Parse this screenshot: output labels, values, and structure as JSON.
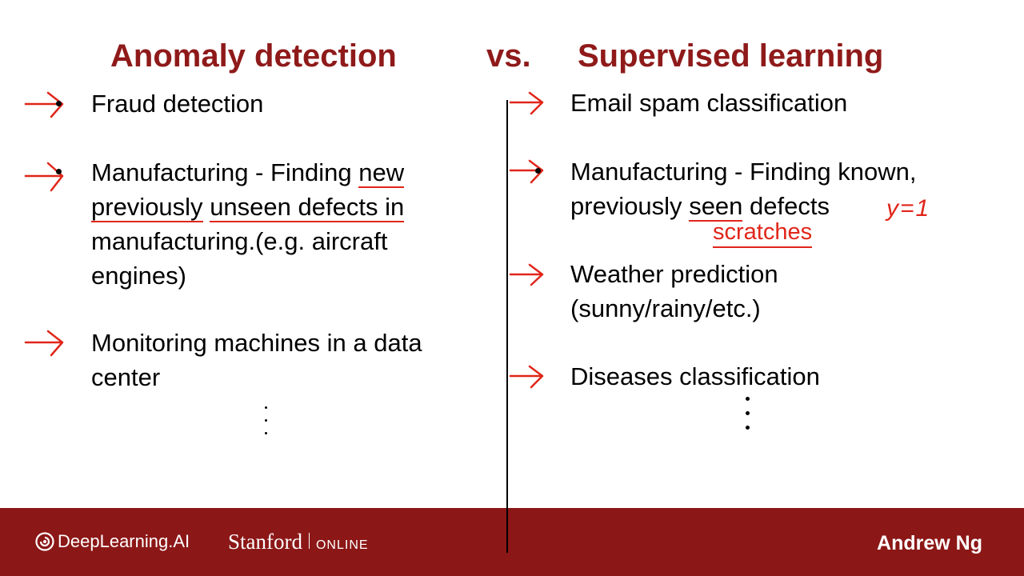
{
  "titles": {
    "left": "Anomaly detection",
    "vs": "vs.",
    "right": "Supervised learning"
  },
  "left_items": [
    "Fraud detection",
    "Manufacturing -  Finding new previously unseen defects in manufacturing.(e.g. aircraft engines)",
    "Monitoring machines in a data center"
  ],
  "left_item2_parts": {
    "a": "Manufacturing -  Finding ",
    "b": "new",
    "c": "previously",
    "d": " ",
    "e": "unseen defects in",
    "f": "manufacturing.(e.g. aircraft",
    "g": "engines)"
  },
  "right_items": [
    "Email spam classification",
    "Manufacturing -  Finding known, previously seen defects",
    "Weather prediction (sunny/rainy/etc.)",
    "Diseases classification"
  ],
  "right_item2_parts": {
    "a": "Manufacturing -  Finding known,",
    "b": "previously ",
    "c": "seen",
    "d": " defects"
  },
  "right_item3_parts": {
    "a": "Weather prediction",
    "b": "(sunny/rainy/etc.)"
  },
  "annotations": {
    "label_eq": "y=1",
    "scratches": "scratches"
  },
  "footer": {
    "deeplearning": "DeepLearning.AI",
    "stanford": "Stanford",
    "online": "ONLINE",
    "author": "Andrew Ng"
  },
  "colors": {
    "title": "#8f1a1a",
    "footer_bg": "#8c1717",
    "ink": "#e0261a"
  }
}
